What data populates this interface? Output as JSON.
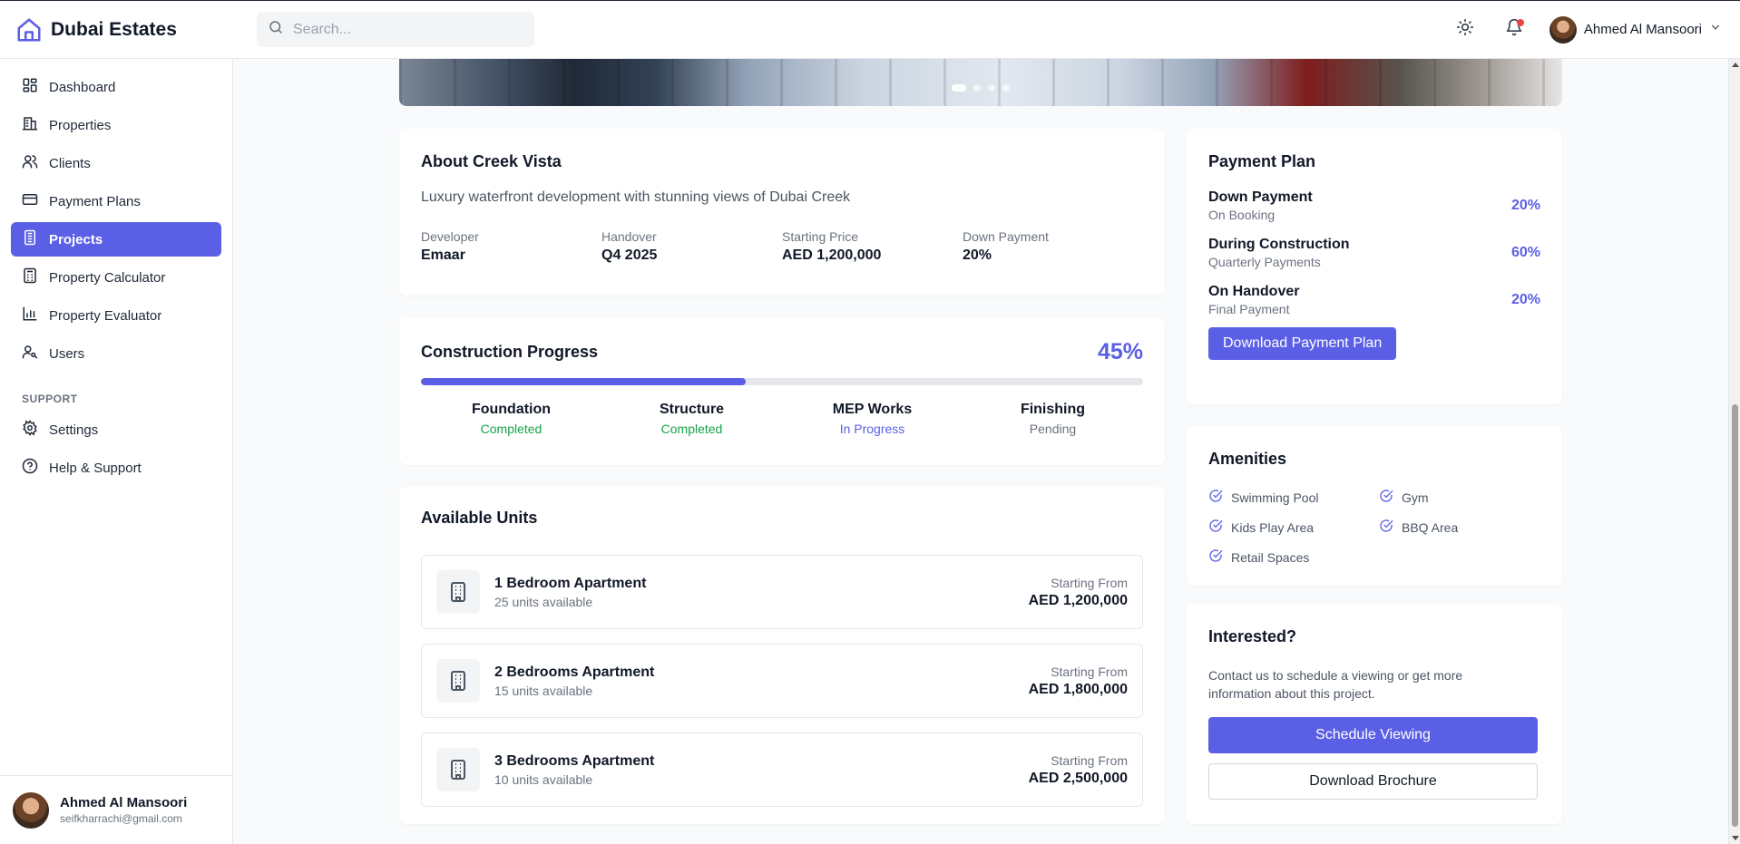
{
  "app": {
    "brand": "Dubai Estates",
    "brand_color": "#5b5fe6"
  },
  "search": {
    "placeholder": "Search..."
  },
  "header": {
    "user_name": "Ahmed Al Mansoori",
    "has_notification": true
  },
  "sidebar": {
    "items": [
      {
        "label": "Dashboard",
        "icon": "dashboard-icon",
        "active": false
      },
      {
        "label": "Properties",
        "icon": "building-icon",
        "active": false
      },
      {
        "label": "Clients",
        "icon": "users-icon",
        "active": false
      },
      {
        "label": "Payment Plans",
        "icon": "credit-card-icon",
        "active": false
      },
      {
        "label": "Projects",
        "icon": "projects-icon",
        "active": true
      },
      {
        "label": "Property Calculator",
        "icon": "calculator-icon",
        "active": false
      },
      {
        "label": "Property Evaluator",
        "icon": "bar-chart-icon",
        "active": false
      },
      {
        "label": "Users",
        "icon": "user-key-icon",
        "active": false
      }
    ],
    "support_heading": "SUPPORT",
    "support_items": [
      {
        "label": "Settings",
        "icon": "gear-icon"
      },
      {
        "label": "Help & Support",
        "icon": "help-icon"
      }
    ],
    "user": {
      "name": "Ahmed Al Mansoori",
      "email": "seifkharrachi@gmail.com"
    }
  },
  "hero": {
    "slide_count": 4,
    "active_slide": 1
  },
  "about": {
    "title": "About Creek Vista",
    "description": "Luxury waterfront development with stunning views of Dubai Creek",
    "stats": [
      {
        "label": "Developer",
        "value": "Emaar"
      },
      {
        "label": "Handover",
        "value": "Q4 2025"
      },
      {
        "label": "Starting Price",
        "value": "AED 1,200,000"
      },
      {
        "label": "Down Payment",
        "value": "20%"
      }
    ]
  },
  "progress": {
    "title": "Construction Progress",
    "percent_label": "45%",
    "percent": 45,
    "stages": [
      {
        "name": "Foundation",
        "status": "Completed",
        "status_color": "#16a34a"
      },
      {
        "name": "Structure",
        "status": "Completed",
        "status_color": "#16a34a"
      },
      {
        "name": "MEP Works",
        "status": "In Progress",
        "status_color": "#5b5fe6"
      },
      {
        "name": "Finishing",
        "status": "Pending",
        "status_color": "#6b7280"
      }
    ]
  },
  "units": {
    "title": "Available Units",
    "items": [
      {
        "name": "1 Bedroom Apartment",
        "availability": "25 units available",
        "price_label": "Starting From",
        "price": "AED 1,200,000"
      },
      {
        "name": "2 Bedrooms Apartment",
        "availability": "15 units available",
        "price_label": "Starting From",
        "price": "AED 1,800,000"
      },
      {
        "name": "3 Bedrooms Apartment",
        "availability": "10 units available",
        "price_label": "Starting From",
        "price": "AED 2,500,000"
      }
    ]
  },
  "payment_plan": {
    "title": "Payment Plan",
    "rows": [
      {
        "name": "Down Payment",
        "sub": "On Booking",
        "pct": "20%"
      },
      {
        "name": "During Construction",
        "sub": "Quarterly Payments",
        "pct": "60%"
      },
      {
        "name": "On Handover",
        "sub": "Final Payment",
        "pct": "20%"
      }
    ],
    "download_label": "Download Payment Plan"
  },
  "amenities": {
    "title": "Amenities",
    "items": [
      "Swimming Pool",
      "Gym",
      "Kids Play Area",
      "BBQ Area",
      "Retail Spaces"
    ]
  },
  "interested": {
    "title": "Interested?",
    "text": "Contact us to schedule a viewing or get more information about this project.",
    "schedule_label": "Schedule Viewing",
    "brochure_label": "Download Brochure"
  }
}
